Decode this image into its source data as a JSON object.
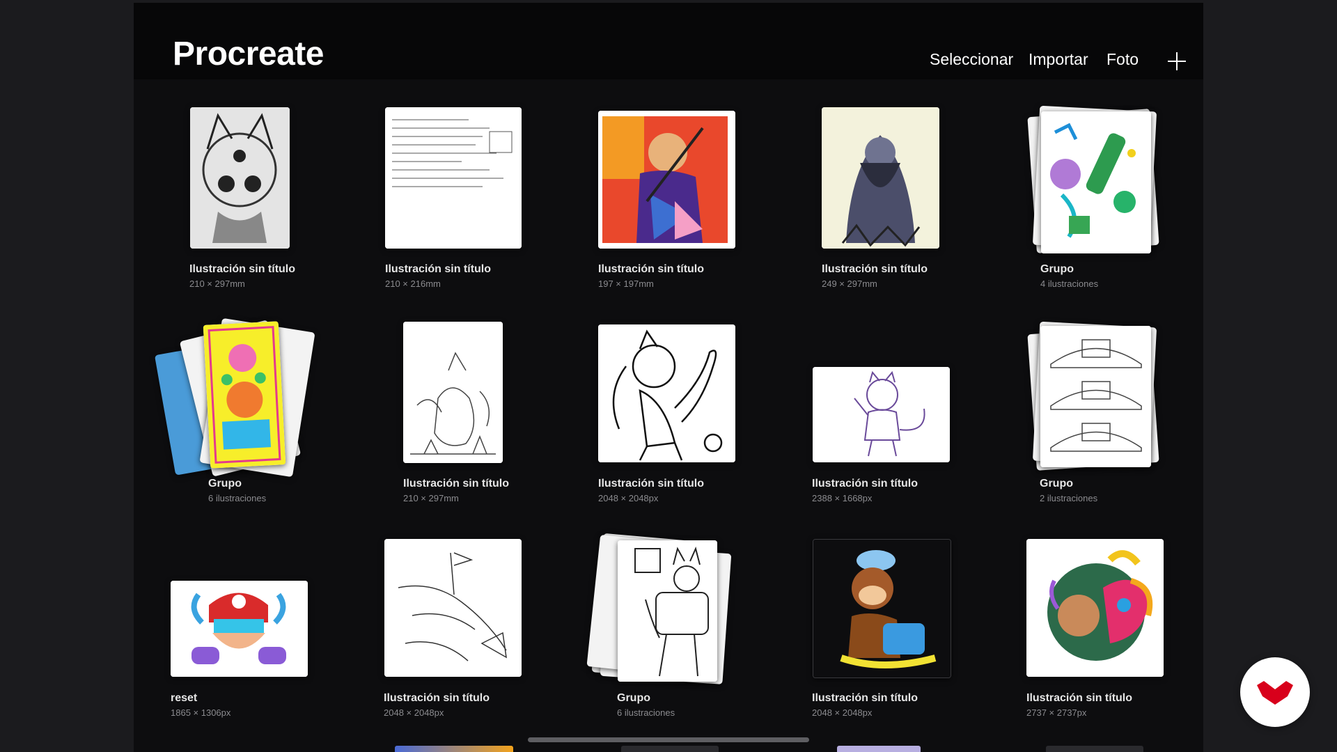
{
  "header": {
    "app_title": "Procreate",
    "actions": {
      "select": "Seleccionar",
      "import": "Importar",
      "photo": "Foto"
    },
    "new_canvas_icon": "plus-icon"
  },
  "gallery": [
    {
      "title": "Ilustración sin título",
      "size": "210 × 297mm"
    },
    {
      "title": "Ilustración sin título",
      "size": "210 × 216mm"
    },
    {
      "title": "Ilustración sin título",
      "size": "197 × 197mm"
    },
    {
      "title": "Ilustración sin título",
      "size": "249 × 297mm"
    },
    {
      "title": "Grupo",
      "size": "4 ilustraciones"
    },
    {
      "title": "Grupo",
      "size": "6 ilustraciones"
    },
    {
      "title": "Ilustración sin título",
      "size": "210 × 297mm"
    },
    {
      "title": "Ilustración sin título",
      "size": "2048 × 2048px"
    },
    {
      "title": "Ilustración sin título",
      "size": "2388 × 1668px"
    },
    {
      "title": "Grupo",
      "size": "2 ilustraciones"
    },
    {
      "title": "reset",
      "size": "1865 × 1306px"
    },
    {
      "title": "Ilustración sin título",
      "size": "2048 × 2048px"
    },
    {
      "title": "Grupo",
      "size": "6 ilustraciones"
    },
    {
      "title": "Ilustración sin título",
      "size": "2048 × 2048px"
    },
    {
      "title": "Ilustración sin título",
      "size": "2737 × 2737px"
    }
  ],
  "badge": {
    "icon": "domestika-logo-icon",
    "color": "#d8001b"
  },
  "colors": {
    "background": "#0d0d0f",
    "header": "#070708",
    "accent": "#d8001b"
  }
}
